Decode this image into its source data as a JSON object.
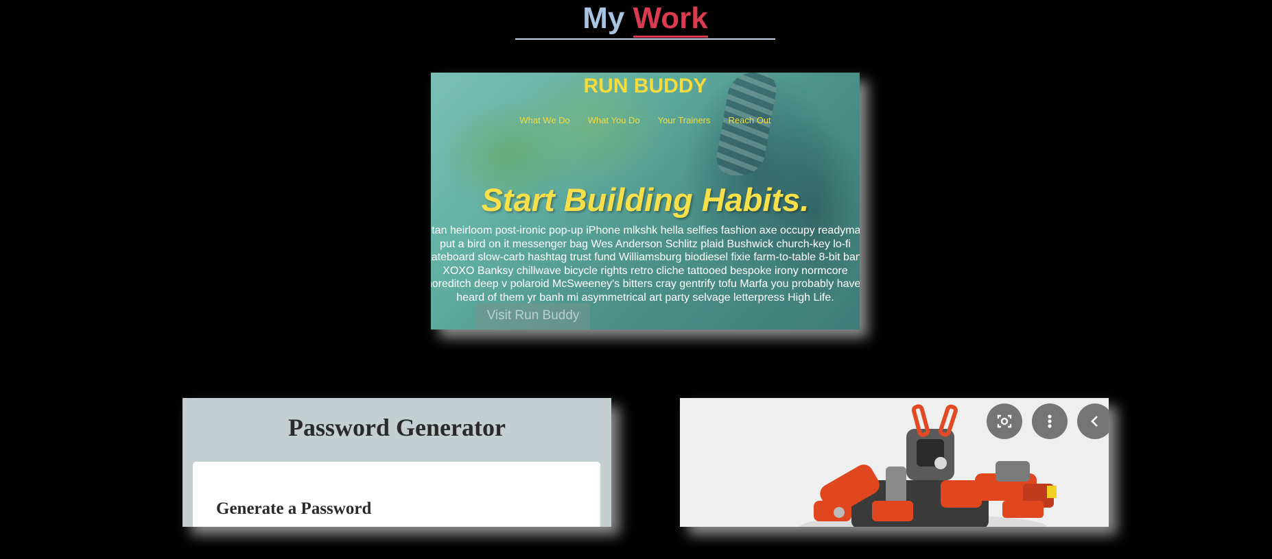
{
  "section": {
    "title_first": "My",
    "title_second": "Work",
    "accent_color": "#dc3a4e",
    "secondary_color": "#a8c4e0"
  },
  "projects": [
    {
      "site_title": "RUN BUDDY",
      "nav": [
        "What We Do",
        "What You Do",
        "Your Trainers",
        "Reach Out"
      ],
      "headline": "Start Building Habits.",
      "body": "seitan heirloom post-ironic pop-up iPhone mlkshk hella selfies fashion axe occupy readymade put a bird on it messenger bag Wes Anderson Schlitz plaid Bushwick church-key lo-fi skateboard slow-carb hashtag trust fund Williamsburg biodiesel fixie farm-to-table 8-bit banjo XOXO Banksy chillwave bicycle rights retro cliche tattooed bespoke irony normcore Shoreditch deep v polaroid McSweeney's bitters cray gentrify tofu Marfa you probably haven't heard of them yr banh mi asymmetrical art party selvage letterpress High Life.",
      "link_label": "Visit Run Buddy",
      "accent_color": "#f5dc3c"
    },
    {
      "site_title": "Password Generator",
      "card_heading": "Generate a Password"
    },
    {
      "image_subject": "orange and grey toy robot",
      "controls": [
        "lens-icon",
        "more-vert-icon",
        "chevron-left-icon"
      ]
    }
  ]
}
